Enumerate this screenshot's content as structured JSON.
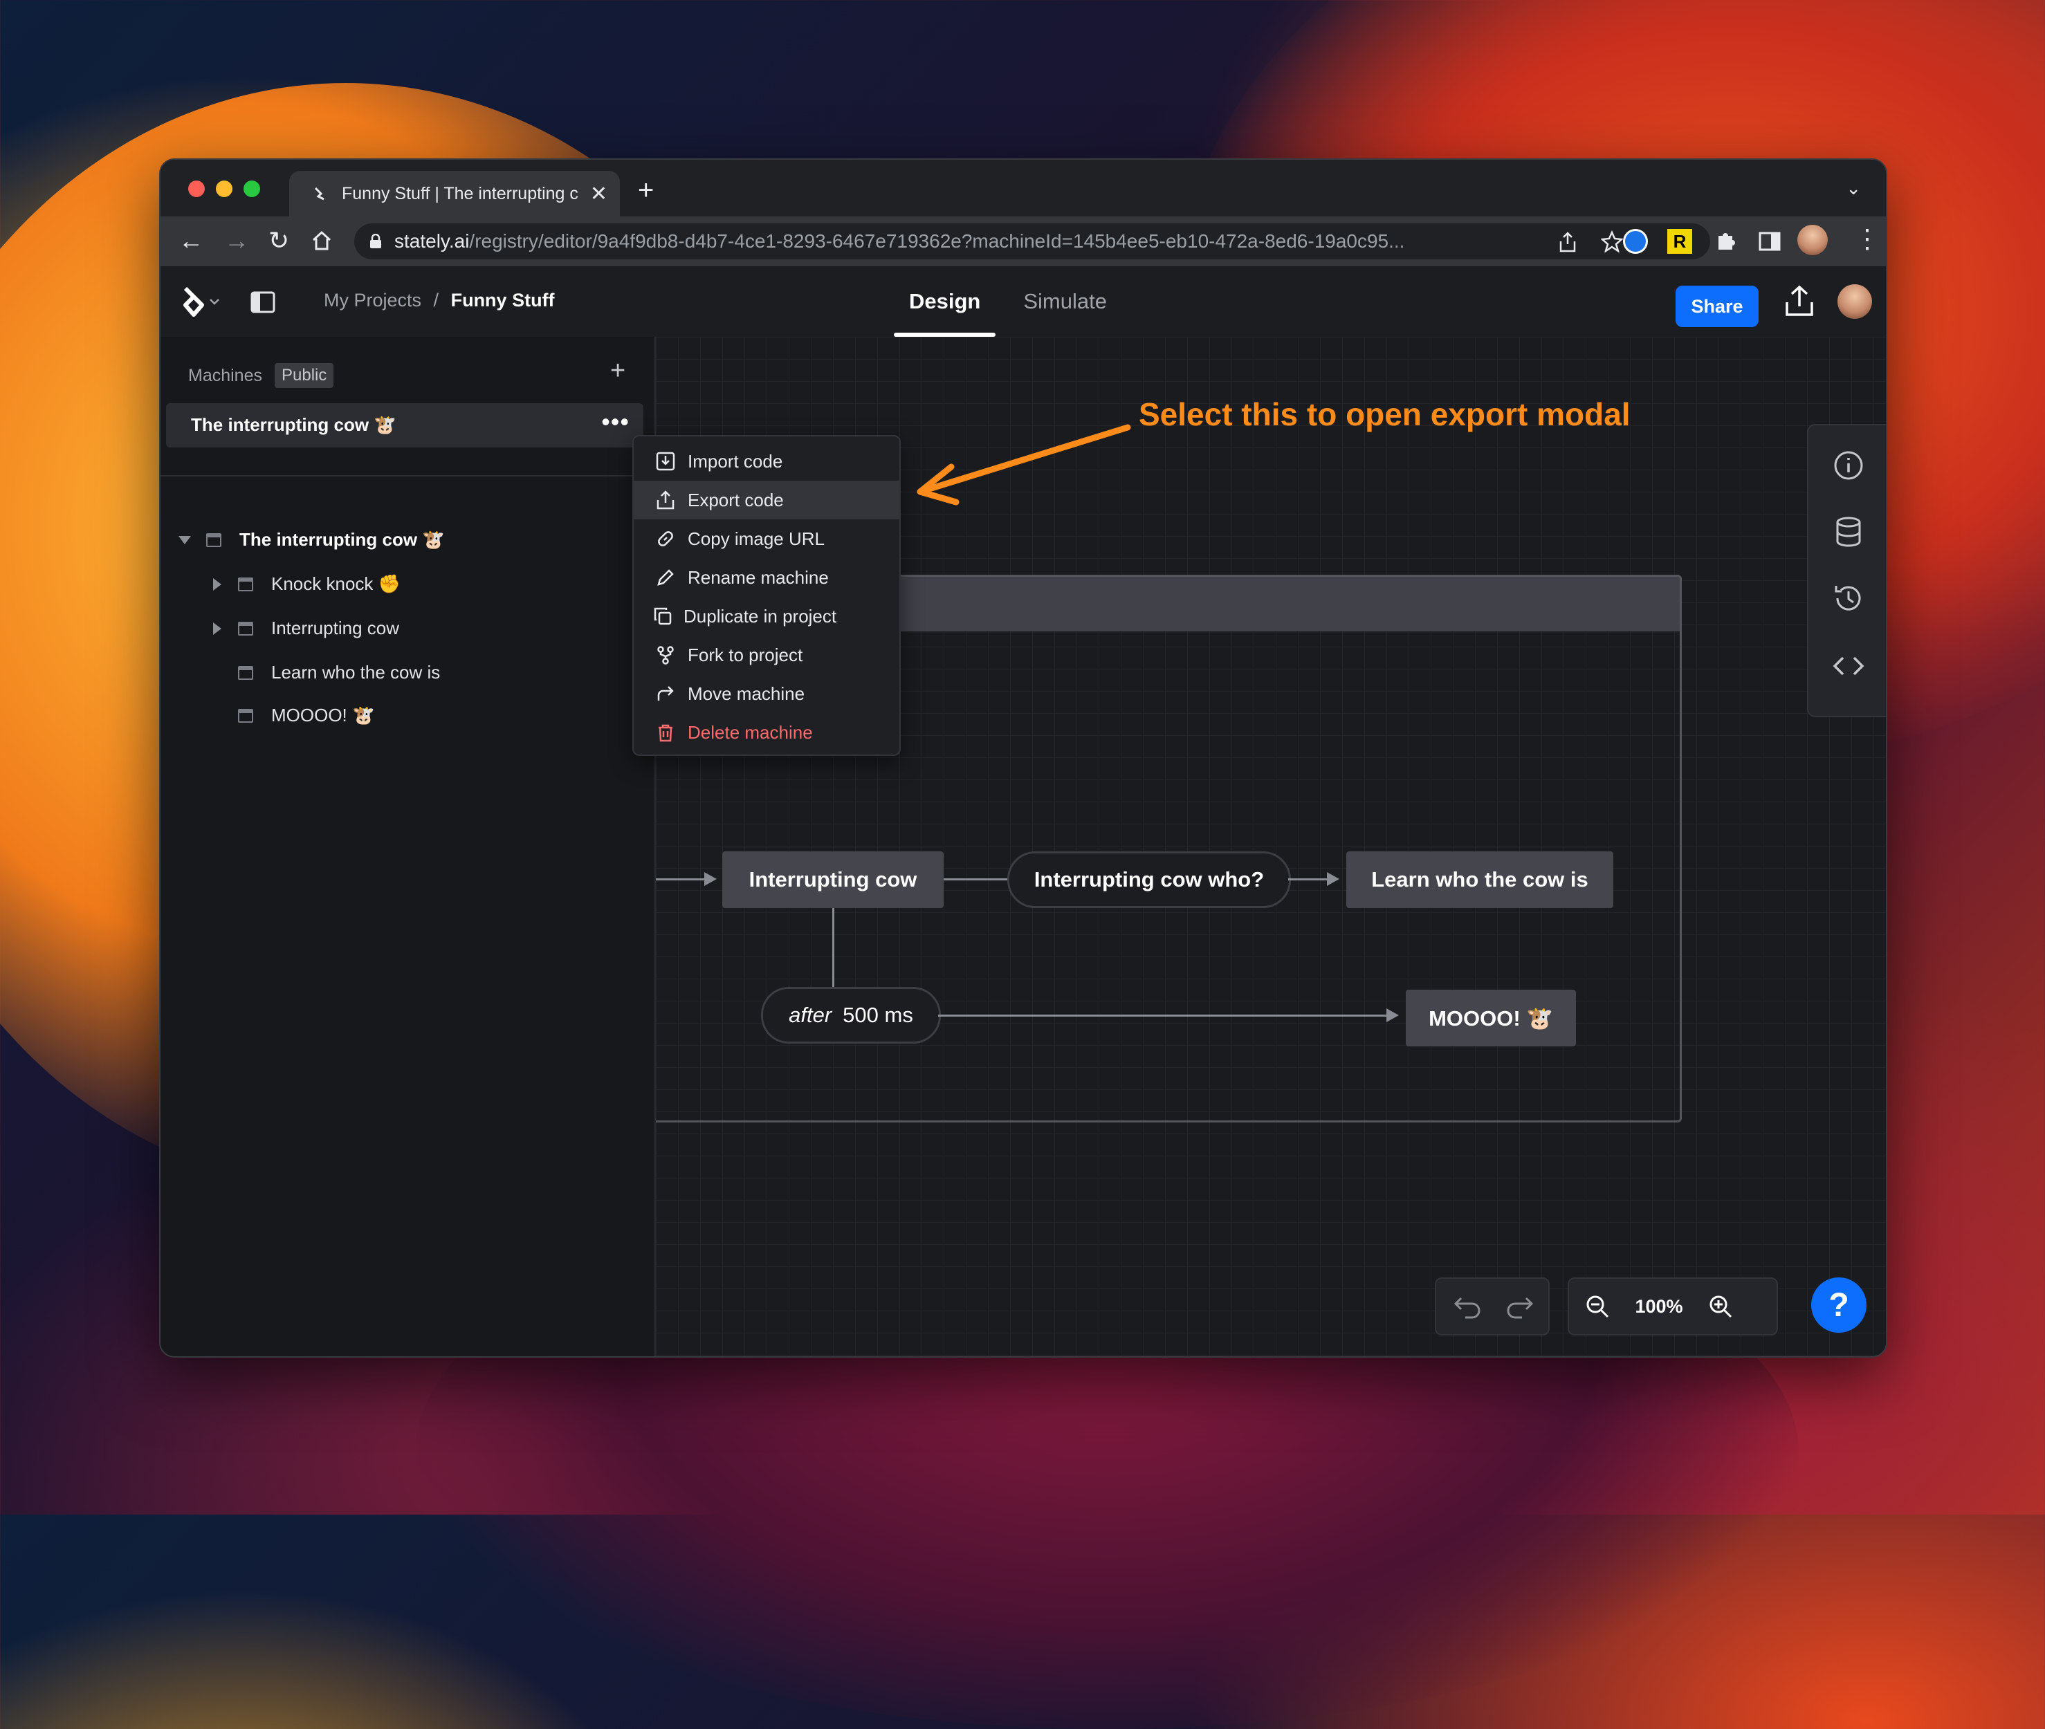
{
  "browser": {
    "tab_title": "Funny Stuff | The interrupting c",
    "url_host": "stately.ai",
    "url_path": "/registry/editor/9a4f9db8-d4b7-4ce1-8293-6467e719362e?machineId=145b4ee5-eb10-472a-8ed6-19a0c95..."
  },
  "header": {
    "breadcrumb_parent": "My Projects",
    "breadcrumb_sep": "/",
    "breadcrumb_current": "Funny Stuff",
    "tabs": [
      {
        "label": "Design"
      },
      {
        "label": "Simulate"
      }
    ],
    "share_label": "Share"
  },
  "sidebar": {
    "heading": "Machines",
    "visibility_badge": "Public",
    "selected_machine": "The interrupting cow 🐮",
    "tree": [
      {
        "label": "The interrupting cow 🐮"
      },
      {
        "label": "Knock knock ✊"
      },
      {
        "label": "Interrupting cow"
      },
      {
        "label": "Learn who the cow is"
      },
      {
        "label": "MOOOO! 🐮"
      }
    ]
  },
  "context_menu": {
    "items": [
      {
        "label": "Import code"
      },
      {
        "label": "Export code"
      },
      {
        "label": "Copy image URL"
      },
      {
        "label": "Rename machine"
      },
      {
        "label": "Duplicate in project"
      },
      {
        "label": "Fork to project"
      },
      {
        "label": "Move machine"
      },
      {
        "label": "Delete machine"
      }
    ]
  },
  "canvas": {
    "states": {
      "interrupting": "Interrupting cow",
      "learn": "Learn who the cow is",
      "moooo": "MOOOO! 🐮"
    },
    "events": {
      "who": "Interrupting cow who?",
      "after_keyword": "after",
      "after_value": "500 ms"
    },
    "zoom": "100%",
    "help": "?"
  },
  "annotation": "Select this to open export modal",
  "colors": {
    "accent": "#0d6efd",
    "annotation": "#ff8c1a",
    "danger": "#ff6b6b"
  }
}
